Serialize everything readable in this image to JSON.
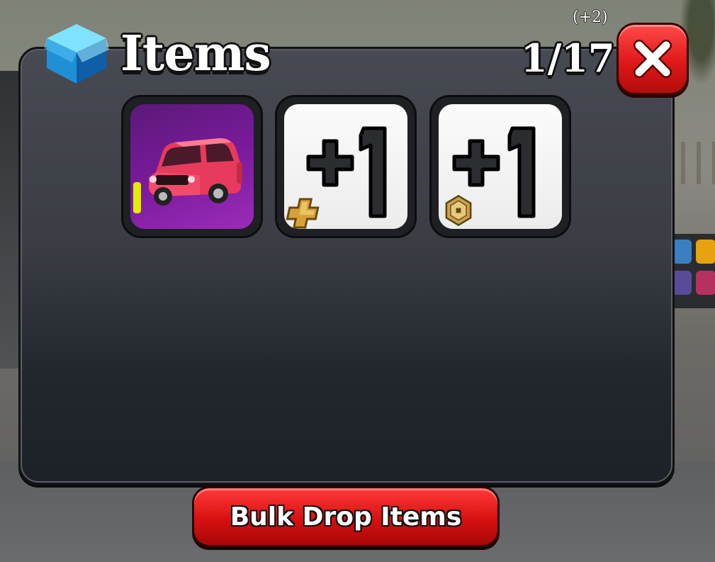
{
  "window": {
    "title": "Items",
    "count": "1/17",
    "bonus": "(+2)"
  },
  "icons": {
    "title": "box-icon",
    "close": "close-icon",
    "premium_badge": "gold-plus-icon",
    "robux_badge": "robux-coin-icon"
  },
  "items": [
    {
      "name": "pink-suv",
      "icon": "car-icon",
      "rarity_color": "#e4ec00",
      "background": "#7a1a9b"
    },
    {
      "name": "plus-one-premium",
      "label": "+1",
      "badge": "gold-plus-icon"
    },
    {
      "name": "plus-one-robux",
      "label": "+1",
      "badge": "robux-coin-icon"
    }
  ],
  "actions": {
    "bulk_drop_label": "Bulk Drop Items"
  },
  "colors": {
    "accent_red": "#e01818",
    "panel": "#3a3d44"
  }
}
